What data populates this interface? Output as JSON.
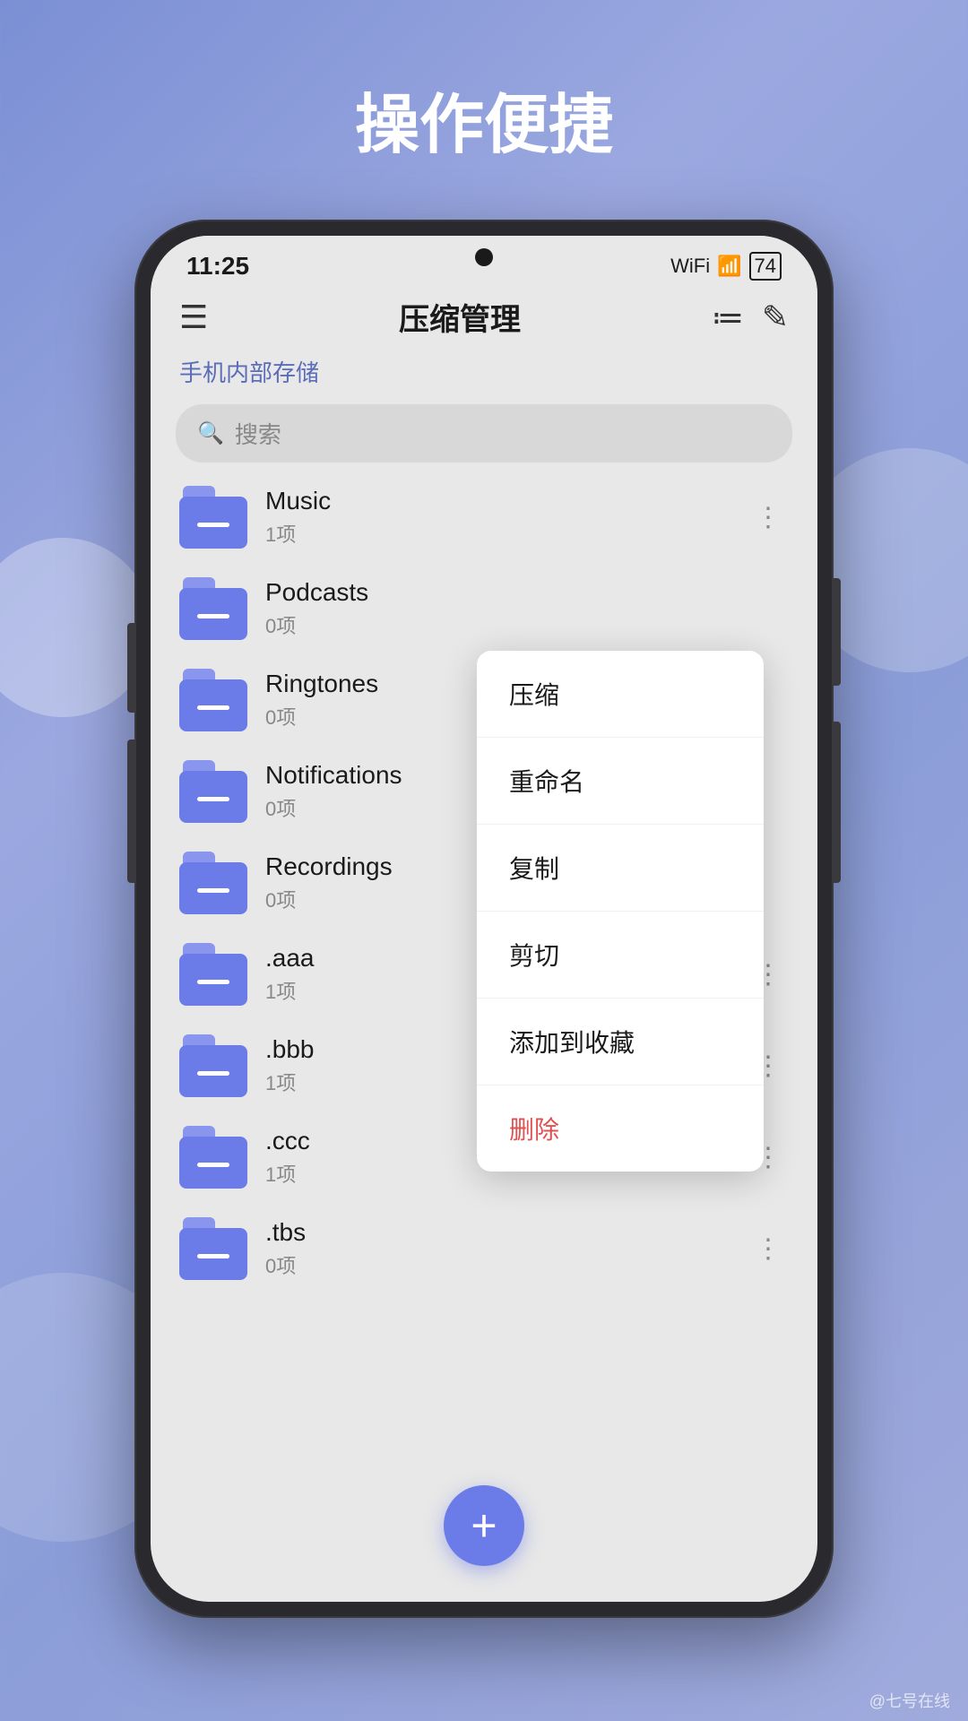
{
  "page": {
    "title": "操作便捷",
    "watermark": "@七号在线"
  },
  "statusbar": {
    "time": "11:25",
    "wifi": "📶",
    "battery_level": "74"
  },
  "toolbar": {
    "title": "压缩管理"
  },
  "breadcrumb": {
    "text": "手机内部存储"
  },
  "search": {
    "placeholder": "搜索"
  },
  "files": [
    {
      "name": "Music",
      "count": "1项"
    },
    {
      "name": "Podcasts",
      "count": "0项"
    },
    {
      "name": "Ringtones",
      "count": "0项"
    },
    {
      "name": "Notifications",
      "count": "0项"
    },
    {
      "name": "Recordings",
      "count": "0项"
    },
    {
      "name": ".aaa",
      "count": "1项",
      "showMore": true
    },
    {
      "name": ".bbb",
      "count": "1项",
      "showMore": true
    },
    {
      "name": ".ccc",
      "count": "1项",
      "showMore": true
    },
    {
      "name": ".tbs",
      "count": "0项",
      "showMore": true
    }
  ],
  "context_menu": {
    "items": [
      {
        "label": "压缩",
        "type": "normal"
      },
      {
        "label": "重命名",
        "type": "normal"
      },
      {
        "label": "复制",
        "type": "normal"
      },
      {
        "label": "剪切",
        "type": "normal"
      },
      {
        "label": "添加到收藏",
        "type": "normal"
      },
      {
        "label": "删除",
        "type": "delete"
      }
    ]
  },
  "fab": {
    "label": "+"
  }
}
